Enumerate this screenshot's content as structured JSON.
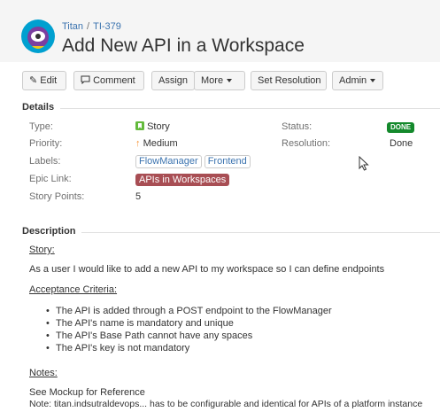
{
  "breadcrumb": {
    "project": "Titan",
    "issue_key": "TI-379"
  },
  "issue": {
    "title": "Add New API in a Workspace"
  },
  "toolbar": {
    "edit": "Edit",
    "comment": "Comment",
    "assign": "Assign",
    "more": "More",
    "set_resolution": "Set Resolution",
    "admin": "Admin"
  },
  "details": {
    "heading": "Details",
    "type_label": "Type:",
    "type_value": "Story",
    "priority_label": "Priority:",
    "priority_value": "Medium",
    "labels_label": "Labels:",
    "labels": [
      "FlowManager",
      "Frontend"
    ],
    "epic_label": "Epic Link:",
    "epic_value": "APIs in Workspaces",
    "points_label": "Story Points:",
    "points_value": "5",
    "status_label": "Status:",
    "status_value": "DONE",
    "resolution_label": "Resolution:",
    "resolution_value": "Done"
  },
  "description": {
    "heading": "Description",
    "story_heading": "Story:",
    "story_text": "As a user I would like to add a new API to my workspace so I can define endpoints",
    "ac_heading": "Acceptance Criteria:",
    "ac_items": [
      "The API is added through a POST endpoint to the FlowManager",
      "The API's name is mandatory and unique",
      "The API's Base Path cannot have any spaces",
      "The API's key is not mandatory"
    ],
    "notes_heading": "Notes:",
    "notes_line1": "See Mockup for Reference",
    "notes_line2": "Note: titan.indsutraldevops... has to be configurable and identical for APIs of a platform instance"
  },
  "colors": {
    "link": "#3b73af",
    "epic": "#a84e54",
    "done": "#14892c",
    "story_icon": "#63ba3c",
    "priority_arrow": "#f79232",
    "avatar_bg": "#00a0d0"
  },
  "icons": {
    "avatar": "project-avatar-icon",
    "edit": "pencil-icon",
    "comment": "comment-icon",
    "type": "story-icon",
    "priority": "arrow-up-icon",
    "cursor": "mouse-cursor-icon"
  }
}
